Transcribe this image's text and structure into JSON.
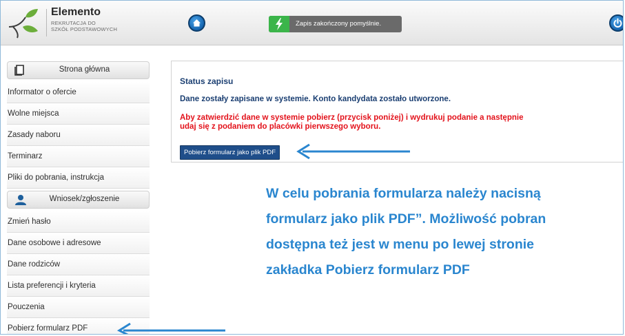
{
  "header": {
    "app_title": "Elemento",
    "app_subtitle_line1": "REKRUTACJA DO",
    "app_subtitle_line2": "SZKÓŁ PODSTAWOWYCH",
    "status_message": "Zapis zakończony pomyślnie."
  },
  "sidebar": {
    "sections": [
      {
        "title": "Strona główna",
        "icon": "document-icon",
        "items": [
          {
            "label": "Informator o ofercie"
          },
          {
            "label": "Wolne miejsca"
          },
          {
            "label": "Zasady naboru"
          },
          {
            "label": "Terminarz"
          },
          {
            "label": "Pliki do pobrania, instrukcja"
          }
        ]
      },
      {
        "title": "Wniosek/zgłoszenie",
        "icon": "user-icon",
        "items": [
          {
            "label": "Zmień hasło"
          },
          {
            "label": "Dane osobowe i adresowe"
          },
          {
            "label": "Dane rodziców"
          },
          {
            "label": "Lista preferencji i kryteria"
          },
          {
            "label": "Pouczenia"
          },
          {
            "label": "Pobierz formularz PDF"
          }
        ]
      }
    ]
  },
  "main": {
    "heading": "Status zapisu",
    "success_text": "Dane zostały zapisane w systemie. Konto kandydata zostało utworzone.",
    "warning_line1": "Aby zatwierdzić dane w systemie pobierz (przycisk poniżej) i wydrukuj podanie a następnie",
    "warning_line2": "udaj się z podaniem do placówki pierwszego wyboru.",
    "pdf_button_label": "Pobierz formularz jako plik PDF"
  },
  "annotation": {
    "lines": [
      "W celu pobrania formularza należy nacisną",
      "formularz jako plik PDF”. Możliwość pobran",
      "dostępna też jest w menu po lewej stronie",
      "zakładka Pobierz formularz PDF"
    ]
  },
  "colors": {
    "accent_blue": "#2a86cf",
    "heading_navy": "#1b3f72",
    "warning_red": "#e3121b",
    "success_green": "#3bb54a"
  }
}
